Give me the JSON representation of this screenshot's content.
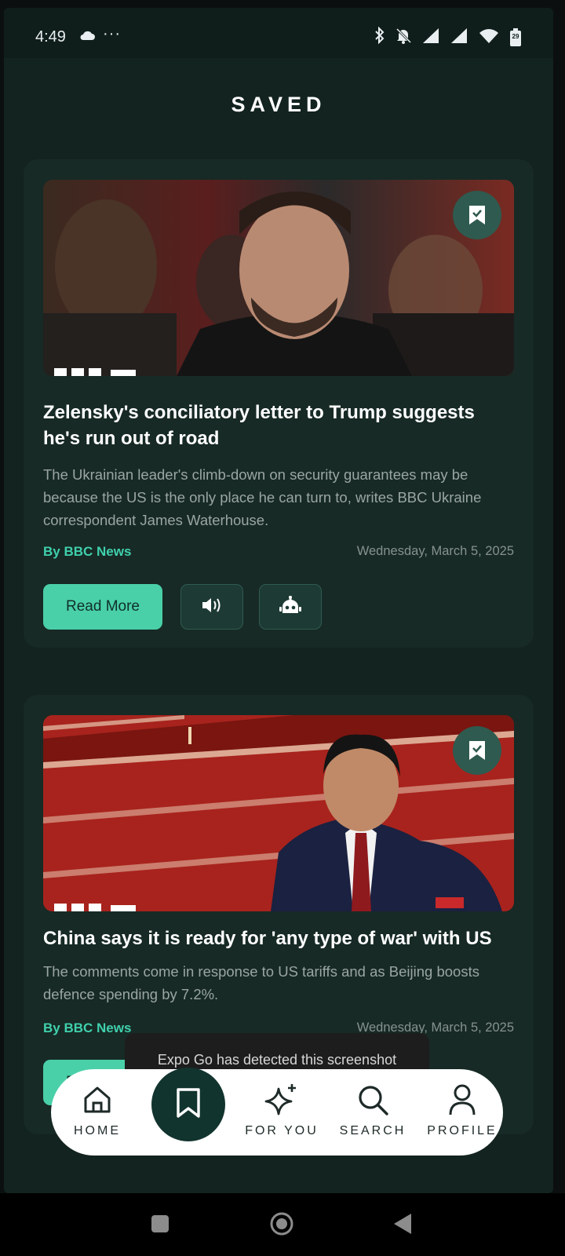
{
  "status_bar": {
    "time": "4:49",
    "dots": "···",
    "battery": "29"
  },
  "page": {
    "title": "SAVED"
  },
  "articles": [
    {
      "headline": "Zelensky's conciliatory letter to Trump suggests he's run out of road",
      "description": "The Ukrainian leader's climb-down on security guarantees may be because the US is the only place he can turn to, writes BBC Ukraine correspondent James Waterhouse.",
      "source": "By BBC News",
      "date": "Wednesday, March 5, 2025",
      "read_more": "Read More"
    },
    {
      "headline": "China says it is ready for 'any type of war' with US",
      "description": "The comments come in response to US tariffs and as Beijing boosts defence spending by 7.2%.",
      "source": "By BBC News",
      "date": "Wednesday, March 5, 2025",
      "read_more": "Read More"
    }
  ],
  "toast": {
    "text": "Expo Go has detected this screenshot"
  },
  "bottom_nav": {
    "items": [
      {
        "label": "HOME",
        "icon": "home-icon"
      },
      {
        "label": "",
        "icon": "bookmark-icon",
        "active": true
      },
      {
        "label": "FOR YOU",
        "icon": "sparkles-icon"
      },
      {
        "label": "SEARCH",
        "icon": "search-icon"
      },
      {
        "label": "PROFILE",
        "icon": "user-icon"
      }
    ]
  },
  "colors": {
    "background": "#13231f",
    "card": "#172a25",
    "accent": "#49d0a8",
    "source_text": "#3fd0ad"
  }
}
